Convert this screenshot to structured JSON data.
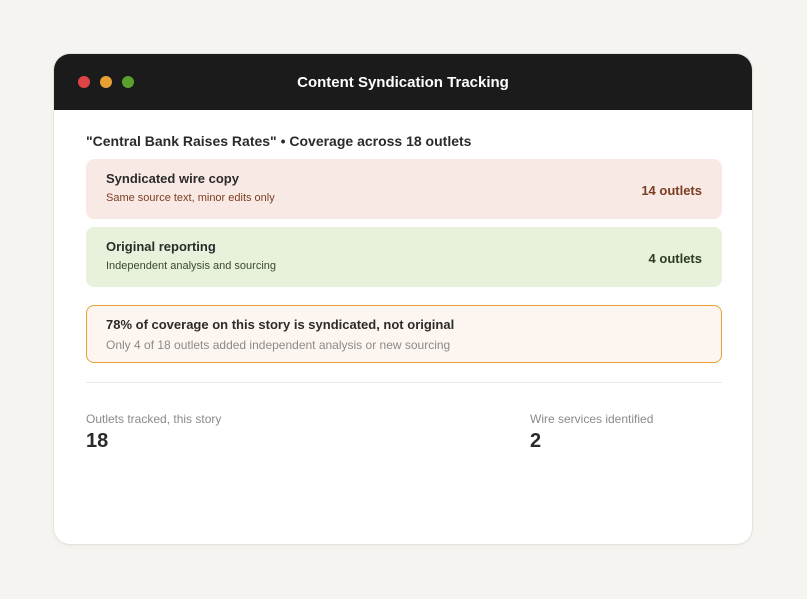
{
  "window": {
    "title": "Content Syndication Tracking"
  },
  "story": {
    "heading": "\"Central Bank Raises Rates\" • Coverage across 18 outlets"
  },
  "cards": {
    "syndicated": {
      "title": "Syndicated wire copy",
      "subtitle": "Same source text, minor edits only",
      "count": "14 outlets"
    },
    "original": {
      "title": "Original reporting",
      "subtitle": "Independent analysis and sourcing",
      "count": "4 outlets"
    }
  },
  "alert": {
    "title": "78% of coverage on this story is syndicated, not original",
    "subtitle": "Only 4 of 18 outlets added independent analysis or new sourcing"
  },
  "stats": {
    "outlets_label": "Outlets tracked, this story",
    "outlets_value": "18",
    "wire_label": "Wire services identified",
    "wire_value": "2"
  },
  "colors": {
    "titlebar": "#1b1b1b",
    "close": "#e04444",
    "minimize": "#e8a034",
    "maximize": "#5aa02c",
    "syndicated_bg": "#f9e9e4",
    "original_bg": "#e7f1dc",
    "alert_border": "#e8a034"
  }
}
